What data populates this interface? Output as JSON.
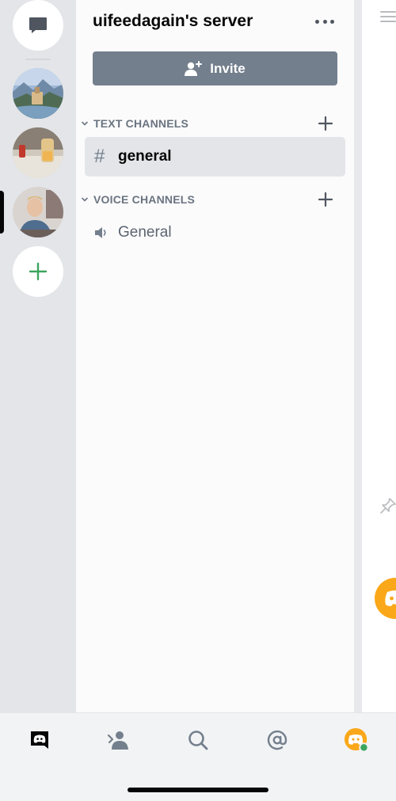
{
  "server": {
    "name": "uifeedagain's server",
    "invite_label": "Invite"
  },
  "categories": {
    "text": {
      "label": "TEXT CHANNELS"
    },
    "voice": {
      "label": "VOICE CHANNELS"
    }
  },
  "channels": {
    "text": [
      {
        "icon": "#",
        "name": "general",
        "selected": true
      }
    ],
    "voice": [
      {
        "icon": "speaker-icon",
        "name": "General"
      }
    ]
  },
  "rail": {
    "items": [
      "direct-messages-icon",
      "server-fantasy-landscape",
      "server-drink-table",
      "server-person-photo",
      "add-server-icon"
    ],
    "selected_index": 3
  },
  "bottom_nav": [
    "discord-home-icon",
    "friends-icon",
    "search-icon",
    "mentions-icon",
    "profile-avatar"
  ],
  "colors": {
    "accent_green": "#3ba55d",
    "avatar_orange": "#faa81a",
    "invite_bg": "#747f8d"
  }
}
